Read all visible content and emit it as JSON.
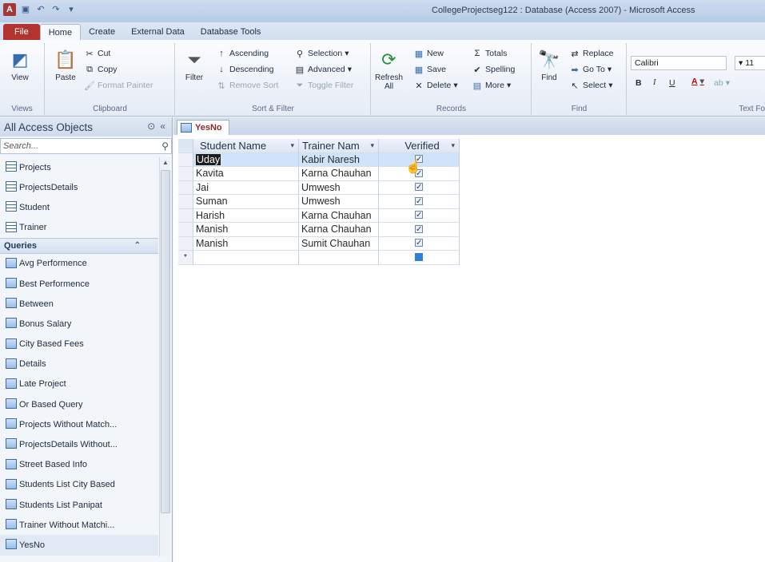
{
  "titlebar": {
    "app_icon": "A",
    "title": "CollegeProjectseg122 : Database (Access 2007) - Microsoft Access"
  },
  "tabs": [
    "File",
    "Home",
    "Create",
    "External Data",
    "Database Tools"
  ],
  "ribbon": {
    "views": {
      "view_label": "View",
      "group": "Views"
    },
    "clipboard": {
      "paste": "Paste",
      "cut": "Cut",
      "copy": "Copy",
      "format_painter": "Format Painter",
      "group": "Clipboard"
    },
    "sort_filter": {
      "filter": "Filter",
      "ascending": "Ascending",
      "descending": "Descending",
      "remove_sort": "Remove Sort",
      "selection": "Selection",
      "advanced": "Advanced",
      "toggle_filter": "Toggle Filter",
      "group": "Sort & Filter"
    },
    "records": {
      "refresh": "Refresh",
      "refresh_sub": "All",
      "new": "New",
      "save": "Save",
      "delete": "Delete",
      "totals": "Totals",
      "spelling": "Spelling",
      "more": "More",
      "group": "Records"
    },
    "find": {
      "find": "Find",
      "replace": "Replace",
      "goto": "Go To",
      "select": "Select",
      "group": "Find"
    },
    "text_format": {
      "font": "Calibri",
      "size": "11",
      "bold": "B",
      "italic": "I",
      "underline": "U",
      "group": "Text Fo"
    }
  },
  "nav": {
    "title": "All Access Objects",
    "search_placeholder": "Search...",
    "tables": [
      "Projects",
      "ProjectsDetails",
      "Student",
      "Trainer"
    ],
    "queries_label": "Queries",
    "queries": [
      "Avg Performence",
      "Best Performence",
      "Between",
      "Bonus Salary",
      "City Based Fees",
      "Details",
      "Late Project",
      "Or Based Query",
      "Projects Without Match...",
      "ProjectsDetails Without...",
      "Street Based Info",
      "Students List City Based",
      "Students List Panipat",
      "Trainer Without Matchi...",
      "YesNo"
    ]
  },
  "document": {
    "tab_label": "YesNo",
    "columns": [
      "Student Name",
      "Trainer Nam",
      "Verified"
    ],
    "rows": [
      {
        "student": "Uday",
        "trainer": "Kabir Naresh",
        "verified": true
      },
      {
        "student": "Kavita",
        "trainer": "Karna Chauhan",
        "verified": true
      },
      {
        "student": "Jai",
        "trainer": "Umwesh",
        "verified": true
      },
      {
        "student": "Suman",
        "trainer": "Umwesh",
        "verified": true
      },
      {
        "student": "Harish",
        "trainer": "Karna Chauhan",
        "verified": true
      },
      {
        "student": "Manish",
        "trainer": "Karna Chauhan",
        "verified": true
      },
      {
        "student": "Manish",
        "trainer": "Sumit Chauhan",
        "verified": true
      }
    ],
    "new_row_marker": "*"
  }
}
